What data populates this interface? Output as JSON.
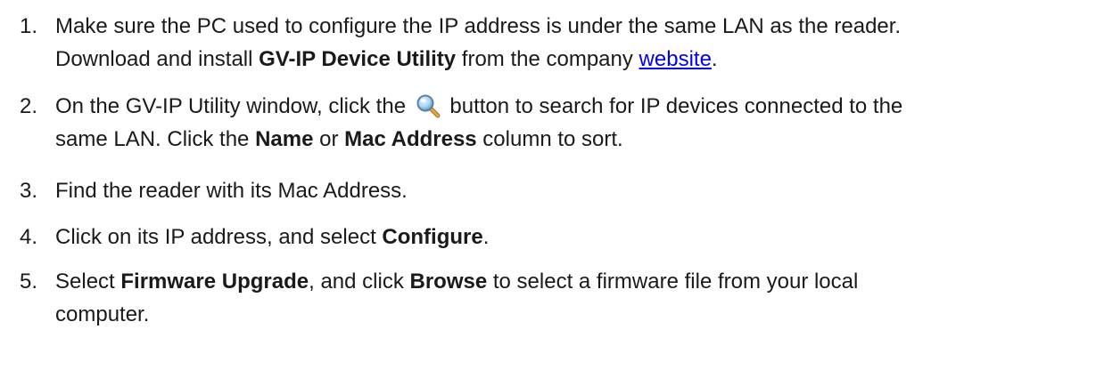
{
  "steps": [
    {
      "number": "1.",
      "lines": [
        {
          "text": "Make sure the PC used to configure the IP address is under the same LAN as the reader."
        },
        {
          "before": "Download and install ",
          "bold": "GV-IP Device Utility",
          "middle": " from the company ",
          "link": "website",
          "after": "."
        }
      ]
    },
    {
      "number": "2.",
      "lines": [
        {
          "before": "On the GV-IP Utility window, click the",
          "after": "button to search for IP devices connected to the"
        },
        {
          "before": "same LAN. Click the ",
          "bold1": "Name",
          "middle": " or ",
          "bold2": "Mac Address",
          "after": " column to sort."
        }
      ]
    },
    {
      "number": "3.",
      "text": "Find the reader with its Mac Address."
    },
    {
      "number": "4.",
      "before": "Click on its IP address, and select ",
      "bold": "Configure",
      "after": "."
    },
    {
      "number": "5.",
      "lines": [
        {
          "before": "Select ",
          "bold1": "Firmware Upgrade",
          "middle": ", and click ",
          "bold2": "Browse",
          "after": " to select a firmware file from your local"
        },
        {
          "text": "computer."
        }
      ]
    }
  ],
  "icons": {
    "search": "magnifier-search-icon"
  }
}
